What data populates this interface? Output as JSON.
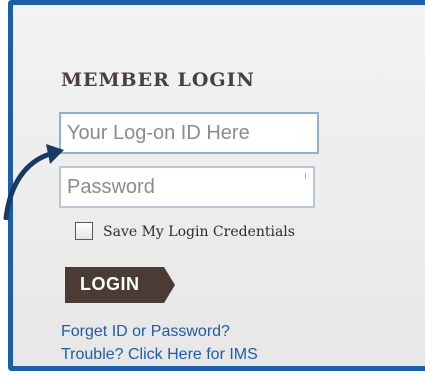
{
  "login": {
    "title": "MEMBER LOGIN",
    "id_placeholder": "Your Log-on ID Here",
    "password_placeholder": "Password",
    "save_label": "Save My Login Credentials",
    "login_label": "LOGIN",
    "forgot_link": "Forget ID or Password?",
    "trouble_link": "Trouble? Click Here for IMS"
  },
  "icons": {
    "annotation_arrow": "curved-arrow-icon"
  },
  "colors": {
    "panel_border": "#1a5fa8",
    "button_bg": "#4a3c35",
    "link": "#1f5ca8",
    "arrow": "#1a3a66"
  }
}
